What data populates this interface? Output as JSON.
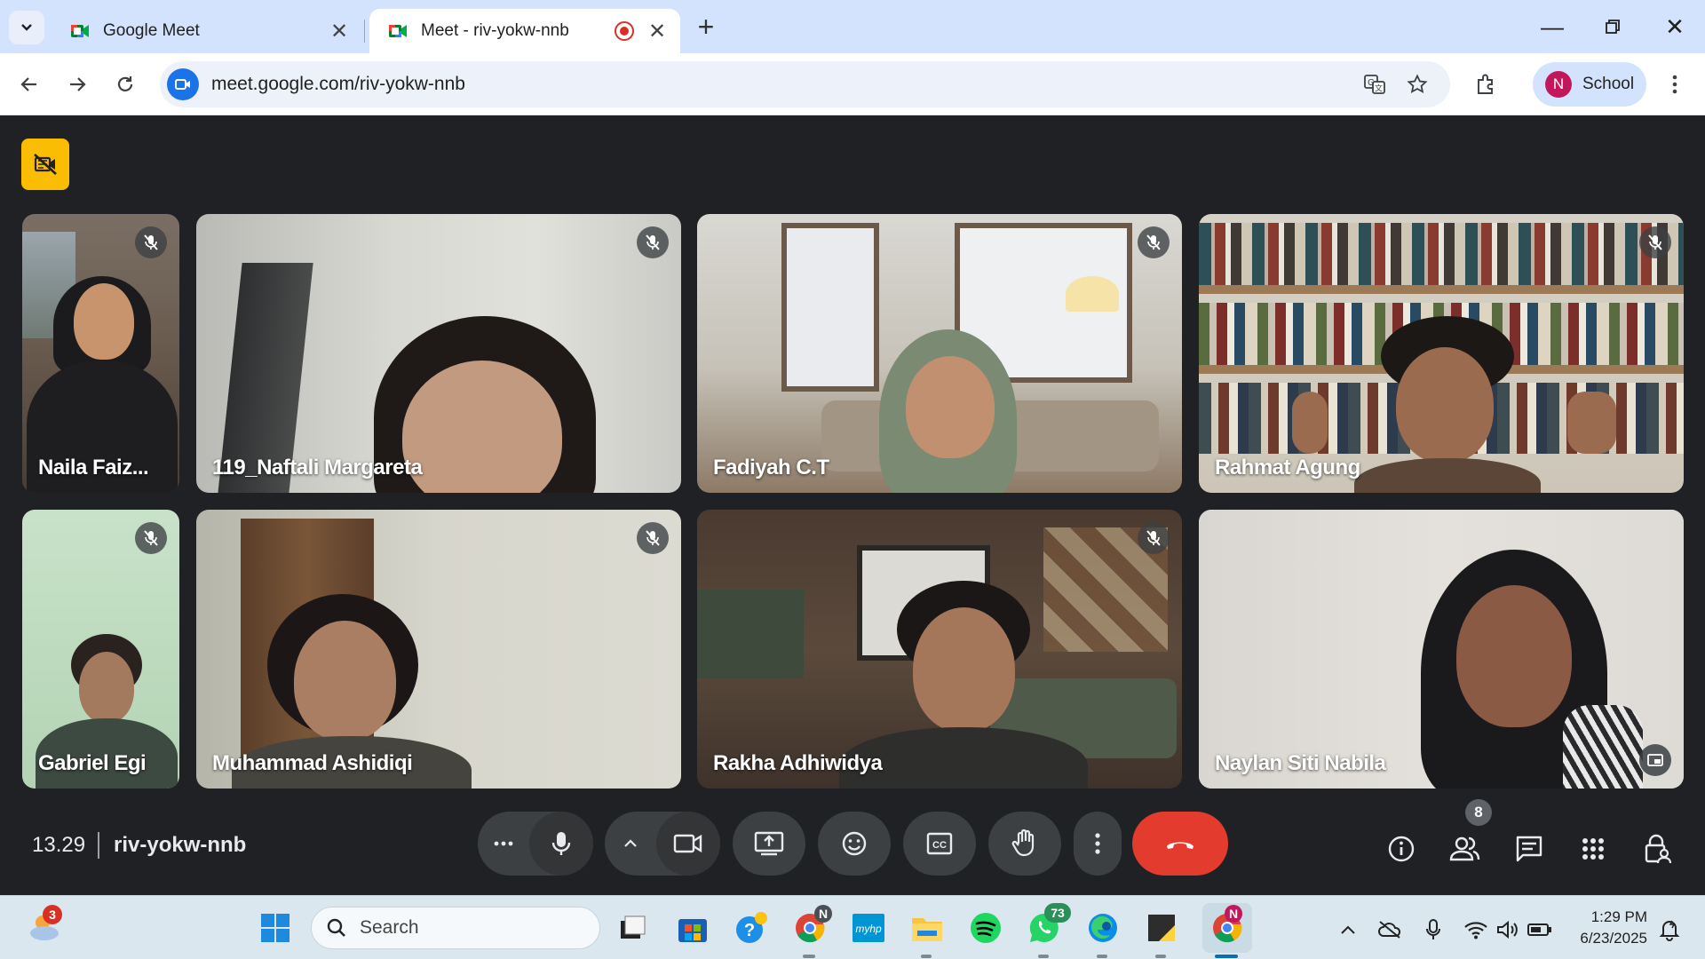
{
  "browser": {
    "tabs": [
      {
        "title": "Google Meet",
        "active": false
      },
      {
        "title": "Meet - riv-yokw-nnb",
        "active": true
      }
    ],
    "url": "meet.google.com/riv-yokw-nnb",
    "profile": {
      "initial": "N",
      "label": "School"
    }
  },
  "meet": {
    "participants": [
      {
        "name": "Naila Faiz...",
        "muted": true
      },
      {
        "name": "119_Naftali Margareta",
        "muted": true
      },
      {
        "name": "Fadiyah C.T",
        "muted": true
      },
      {
        "name": "Rahmat Agung",
        "muted": true
      },
      {
        "name": "Gabriel Egi",
        "muted": true
      },
      {
        "name": "Muhammad Ashidiqi",
        "muted": true
      },
      {
        "name": "Rakha Adhiwidya",
        "muted": true
      },
      {
        "name": "Naylan Siti Nabila",
        "muted": false,
        "speaking": true
      }
    ],
    "time": "13.29",
    "code": "riv-yokw-nnb",
    "people_count": "8"
  },
  "taskbar": {
    "search_placeholder": "Search",
    "weather_badge": "3",
    "whatsapp_badge": "73",
    "chrome_badge": "N",
    "time": "1:29 PM",
    "date": "6/23/2025"
  },
  "colors": {
    "meet_bg": "#202124",
    "tabbar_bg": "#d3e3fd",
    "end_call": "#e33b2e",
    "host_badge": "#fbbc04",
    "speaking_outline": "#a8c7fa"
  }
}
